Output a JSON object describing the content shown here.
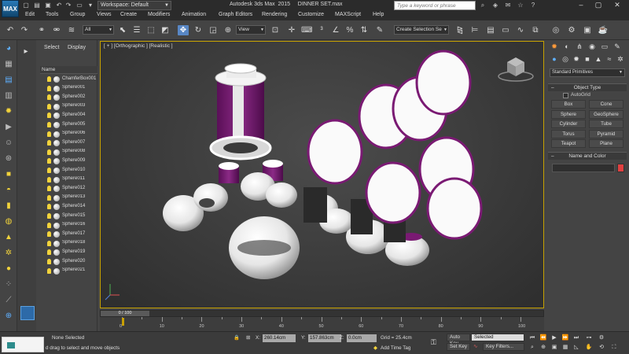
{
  "app": {
    "logo": "MAX",
    "title": "Autodesk 3ds Max  2015     DINNER SET.max",
    "workspace": "Workspace: Default",
    "search_placeholder": "Type a keyword or phrase"
  },
  "menu": [
    "Edit",
    "Tools",
    "Group",
    "Views",
    "Create",
    "Modifiers",
    "Animation",
    "Graph Editors",
    "Rendering",
    "Customize",
    "MAXScript",
    "Help"
  ],
  "toolbar": {
    "filter_value": "All",
    "reference_coord": "View",
    "selection_set_placeholder": "Create Selection Se"
  },
  "explorer": {
    "tabs": [
      "Select",
      "Display"
    ],
    "column_header": "Name",
    "items": [
      "ChamferBox001",
      "Sphere001",
      "Sphere002",
      "Sphere003",
      "Sphere004",
      "Sphere005",
      "Sphere006",
      "Sphere007",
      "Sphere008",
      "Sphere009",
      "Sphere010",
      "Sphere011",
      "Sphere012",
      "Sphere013",
      "Sphere014",
      "Sphere015",
      "Sphere016",
      "Sphere017",
      "Sphere018",
      "Sphere019",
      "Sphere020",
      "Sphere021"
    ]
  },
  "viewport": {
    "label": "[ + ] [Orthographic ] [Realistic ]"
  },
  "command_panel": {
    "category": "Standard Primitives",
    "object_type_title": "Object Type",
    "autogrid": "AutoGrid",
    "buttons": [
      "Box",
      "Cone",
      "Sphere",
      "GeoSphere",
      "Cylinder",
      "Tube",
      "Torus",
      "Pyramid",
      "Teapot",
      "Plane"
    ],
    "name_color_title": "Name and Color",
    "color": "#e04040"
  },
  "timeline": {
    "slider_label": "0 / 100",
    "ticks": [
      "0",
      "10",
      "20",
      "30",
      "40",
      "50",
      "60",
      "70",
      "80",
      "90",
      "100"
    ]
  },
  "status": {
    "selection": "None Selected",
    "prompt": "d drag to select and move objects",
    "x_label": "X:",
    "x_value": "260.14cm",
    "y_label": "Y:",
    "y_value": "157.863cm",
    "z_label": "Z:",
    "z_value": "0.0cm",
    "grid": "Grid = 25.4cm",
    "add_time_tag": "Add Time Tag",
    "auto_key": "Auto Key",
    "set_key": "Set Key",
    "selected_option": "Selected",
    "key_filters": "Key Filters..."
  },
  "colors": {
    "accent_purple": "#7a1a73",
    "viewport_border": "#c6a100",
    "active_tool": "#5887c5"
  }
}
